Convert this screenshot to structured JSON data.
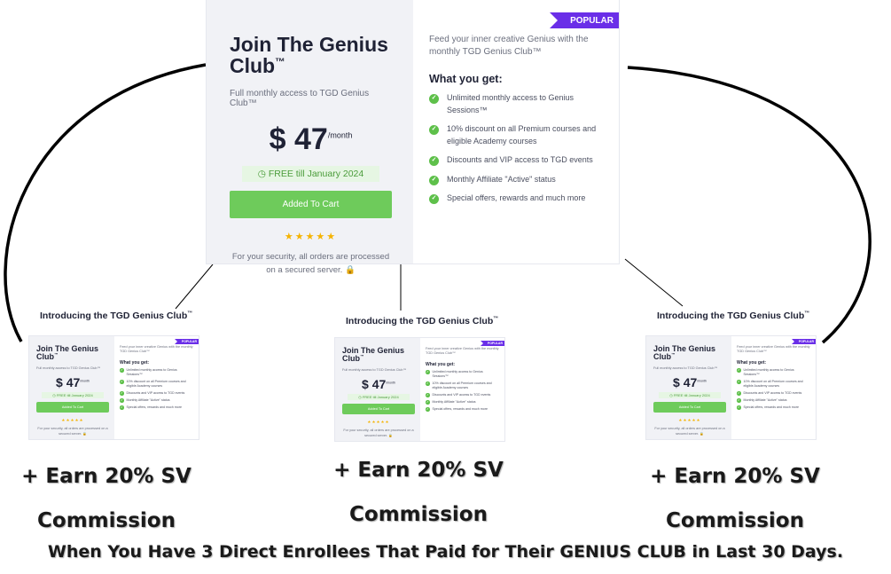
{
  "card": {
    "badge": "POPULAR",
    "title_line1": "Join The Genius",
    "title_line2": "Club",
    "tm": "™",
    "subtitle": "Full monthly access to TGD Genius Club™",
    "price": "$ 47",
    "price_suffix": "/month",
    "free_note": "FREE till January 2024",
    "clock_icon": "clock-icon",
    "cart_button": "Added To Cart",
    "stars": "★★★★★",
    "security_note": "For your security, all orders are processed on a secured server.",
    "lock_icon": "lock-icon",
    "feed": "Feed your inner creative Genius with the monthly TGD Genius Club™",
    "what_you_get": "What you get:",
    "features": [
      "Unlimited monthly access to Genius Sessions™",
      "10% discount on all Premium courses and eligible Academy courses",
      "Discounts and VIP access to TGD events",
      "Monthly Affiliate \"Active\" status",
      "Special offers, rewards and much more"
    ],
    "colors": {
      "accent": "#6a2ee8",
      "green": "#6ecb5b",
      "check": "#5ec04a"
    }
  },
  "small_cards": [
    {
      "intro": "Introducing the TGD Genius Club",
      "earn_line1": "+ Earn 20% SV",
      "earn_line2": "Commission"
    },
    {
      "intro": "Introducing the TGD Genius Club",
      "earn_line1": "+ Earn 20% SV",
      "earn_line2": "Commission"
    },
    {
      "intro": "Introducing the TGD Genius Club",
      "earn_line1": "+ Earn 20% SV",
      "earn_line2": "Commission"
    }
  ],
  "footer": "When You Have 3 Direct Enrollees That Paid for Their GENIUS CLUB in Last 30 Days."
}
